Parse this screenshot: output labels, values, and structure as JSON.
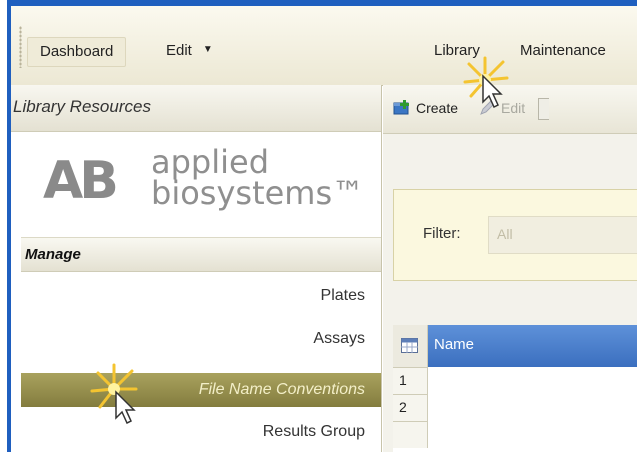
{
  "menubar": {
    "dashboard": "Dashboard",
    "edit": "Edit",
    "library": "Library",
    "maintenance": "Maintenance"
  },
  "left_panel": {
    "title": "Library Resources",
    "logo": {
      "mark": "AB",
      "line1": "applied",
      "line2": "biosystems™"
    },
    "section": "Manage",
    "items": [
      {
        "label": "Plates",
        "selected": false
      },
      {
        "label": "Assays",
        "selected": false
      },
      {
        "label": "File Name Conventions",
        "selected": true
      },
      {
        "label": "Results Group",
        "selected": false
      }
    ]
  },
  "toolbar": {
    "create": "Create",
    "edit": "Edit"
  },
  "filter": {
    "label": "Filter:",
    "value": "All"
  },
  "grid": {
    "columns": [
      "Name"
    ],
    "row_numbers": [
      "1",
      "2"
    ]
  },
  "colors": {
    "frame_blue": "#1f5fbf",
    "selected_olive": "#958e4c",
    "header_blue": "#4a7fcc"
  }
}
